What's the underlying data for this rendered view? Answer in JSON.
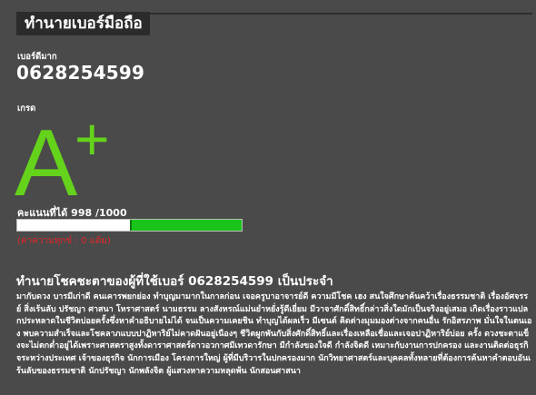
{
  "page": {
    "title": "ทำนายเบอร์มือถือ"
  },
  "number_section": {
    "label": "เบอร์ดีมาก",
    "phone": "0628254599"
  },
  "grade_section": {
    "label": "เกรด",
    "grade": "A",
    "grade_mod": "+",
    "grade_color": "#65d21b"
  },
  "score_section": {
    "label": "คะแนนที่ได้",
    "score": "998",
    "total": "/1000",
    "progress_fraction": 0.5,
    "bar_color": "#1ac41a",
    "bad_text": "(ค่าความทุกข์ : 0 แต้ม)",
    "bad_color": "#e12828"
  },
  "reading": {
    "heading": "ทำนายโชคชะตาของผู้ที่ใช้เบอร์ 0628254599 เป็นประจำ",
    "text": "มากับดวง บารมีเก่าดี คนเคารพยกย่อง ทำบุญมามากในกาลก่อน เจอครูบาอาจารย์ดี ความมีโชค เฮง สนใจศึกษาค้นคว้าเรื่องธรรมชาติ เรื่องอัศจรรย์ สิ่งเร้นลับ ปรัชญา ศาสนา โหราศาสตร์ นามธรรม ลางสังหรณ์แม่นยำหยั่งรู้ดีเยี่ยม มีวาจาศักดิ์สิทธิ์กล่าวสิ่งใดมักเป็นจริงอยู่เสมอ เกิดเรื่องราวแปลกประหลาดในชีวิตบ่อยครั้งซึ่งหาคำอธิบายไม่ได้ จนเป็นความเคยชิน ทำบุญได้ผลเร็ว มีเซนต์ คิดต่างมุมมองต่างจากคนอื่น รักอิสรภาพ มั่นใจในตนเอง พบความสำเร็จและโชคลาภแบบปาฏิหาริย์ไม่คาดฝันอยู่เนืองๆ ชีวิตผูกพันกับสิ่งศักดิ์สิทธิ์และเรื่องเหลือเชื่อและเจอปาฏิหาริย์บ่อย ครั้ง ดวงชะตาแข็งจะไม่ตกต่ำอยู่ได้เพราะศาสตราสูงทั้งดาราศาสตร์ดาวอวกาศมีเทวดารักษา มีกำลังของใจดี กำลังจิตดี เหมาะกับงานการปกครอง และงานติดต่อธุรกิจระหว่างประเทศ เจ้าของธุรกิจ นักการเมือง โครงการใหญ่ ผู้ที่มีบริวารในปกครองมาก นักวิทยาศาสตร์และบุคคลทั้งหลายที่ต้องการค้นหาคำตอบอันเร้นลับของธรรมชาติ นักปรัชญา นักพลังจิต ผู้แสวงหาความหลุดพ้น นักสอนศาสนา"
  }
}
